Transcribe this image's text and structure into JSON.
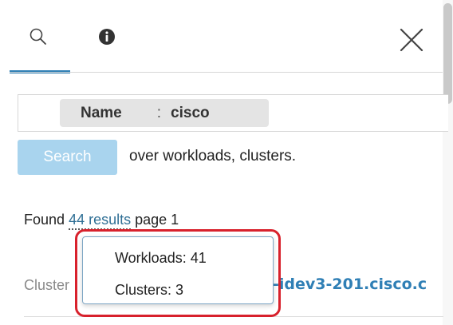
{
  "tabs": [
    {
      "icon": "search-icon",
      "active": true
    },
    {
      "icon": "info-icon",
      "active": false
    }
  ],
  "close_icon": "close-icon",
  "filter": {
    "key": "Name",
    "separator": ":",
    "value": "cisco"
  },
  "search": {
    "button_label": "Search",
    "scope_text": "over workloads, clusters."
  },
  "results": {
    "prefix": "Found",
    "link_text": "44 results",
    "suffix": "page 1"
  },
  "result_row": {
    "label": "Cluster",
    "link_text": "-idev3-201.cisco.c"
  },
  "popover": {
    "items": [
      "Workloads: 41",
      "Clusters: 3"
    ]
  },
  "colors": {
    "accent": "#2f7fb5",
    "button_disabled": "#a9d4ee",
    "highlight": "#d8212c"
  }
}
